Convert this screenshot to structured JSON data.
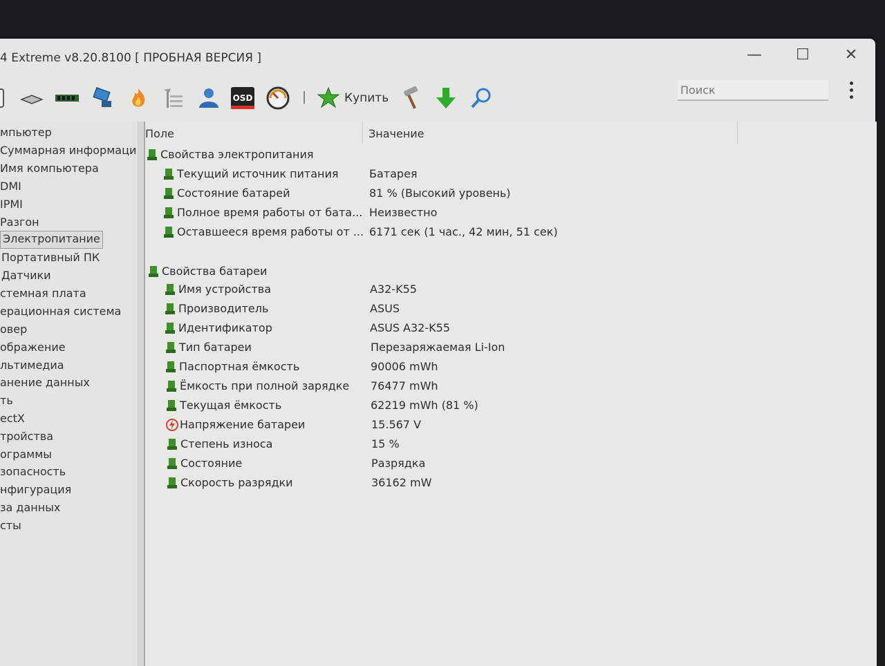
{
  "window": {
    "title": "4 Extreme v8.20.8100  [ ПРОБНАЯ ВЕРСИЯ ]",
    "minimize": "—",
    "maximize": "☐",
    "close": "✕"
  },
  "toolbar": {
    "icons": [
      "computer-icon",
      "motherboard-icon",
      "memory-icon",
      "network-icon",
      "burn-icon",
      "benchmark-icon",
      "user-icon",
      "osd-icon",
      "gauge-icon"
    ],
    "osd_label": "OSD",
    "buy_label": "Купить",
    "tool_icons": [
      "tools-icon",
      "download-icon",
      "search-icon"
    ]
  },
  "search": {
    "placeholder": "Поиск"
  },
  "sidebar": {
    "items": [
      {
        "label": "мпьютер"
      },
      {
        "label": "Суммарная информация"
      },
      {
        "label": "Имя компьютера"
      },
      {
        "label": "DMI"
      },
      {
        "label": "IPMI"
      },
      {
        "label": "Разгон"
      },
      {
        "label": "Электропитание"
      },
      {
        "label": "Портативный ПК"
      },
      {
        "label": "Датчики"
      },
      {
        "label": "стемная плата"
      },
      {
        "label": "ерационная система"
      },
      {
        "label": "овер"
      },
      {
        "label": "ображение"
      },
      {
        "label": "льтимедиа"
      },
      {
        "label": "анение данных"
      },
      {
        "label": "ть"
      },
      {
        "label": "ectX"
      },
      {
        "label": "тройства"
      },
      {
        "label": "ограммы"
      },
      {
        "label": "зопасность"
      },
      {
        "label": "нфигурация"
      },
      {
        "label": "за данных"
      },
      {
        "label": "сты"
      }
    ]
  },
  "table": {
    "headers": {
      "field": "Поле",
      "value": "Значение"
    },
    "groups": [
      {
        "title": "Свойства электропитания",
        "rows": [
          {
            "field": "Текущий источник питания",
            "value": "Батарея"
          },
          {
            "field": "Состояние батарей",
            "value": "81 % (Высокий уровень)"
          },
          {
            "field": "Полное время работы от бата...",
            "value": "Неизвестно"
          },
          {
            "field": "Оставшееся время работы от ...",
            "value": "6171 сек (1 час., 42 мин, 51 сек)"
          }
        ]
      },
      {
        "title": "Свойства батареи",
        "rows": [
          {
            "field": "Имя устройства",
            "value": "A32-K55"
          },
          {
            "field": "Производитель",
            "value": "ASUS"
          },
          {
            "field": "Идентификатор",
            "value": "ASUS A32-K55"
          },
          {
            "field": "Тип батареи",
            "value": "Перезаряжаемая Li-Ion"
          },
          {
            "field": "Паспортная ёмкость",
            "value": "90006 mWh"
          },
          {
            "field": "Ёмкость при полной зарядке",
            "value": "76477 mWh"
          },
          {
            "field": "Текущая ёмкость",
            "value": "62219 mWh  (81 %)"
          },
          {
            "field": "Напряжение батареи",
            "value": "15.567 V"
          },
          {
            "field": "Степень износа",
            "value": "15 %"
          },
          {
            "field": "Состояние",
            "value": "Разрядка"
          },
          {
            "field": "Скорость разрядки",
            "value": "36162 mW"
          }
        ]
      }
    ]
  },
  "colors": {
    "battery_icon": "#3f8f2a",
    "voltage_icon": "#d2452e",
    "buy_icon": "#3faa2e",
    "download_icon": "#2eab2b",
    "search_icon": "#2f7fd0"
  }
}
